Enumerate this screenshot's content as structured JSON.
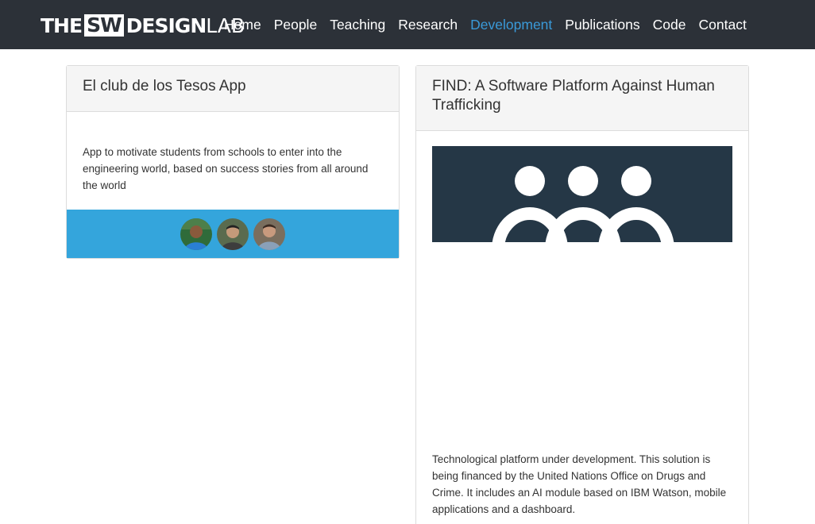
{
  "brand": {
    "part1": "THE",
    "part2": "SW",
    "part3": "DESIGN",
    "part4": "LAB"
  },
  "nav": {
    "items": [
      {
        "label": "Home",
        "active": false
      },
      {
        "label": "People",
        "active": false
      },
      {
        "label": "Teaching",
        "active": false
      },
      {
        "label": "Research",
        "active": false
      },
      {
        "label": "Development",
        "active": true
      },
      {
        "label": "Publications",
        "active": false
      },
      {
        "label": "Code",
        "active": false
      },
      {
        "label": "Contact",
        "active": false
      }
    ]
  },
  "projects": [
    {
      "title": "El club de los Tesos App",
      "description": "App to motivate students from schools to enter into the engineering world, based on success stories from all around the world",
      "team_count": 3
    },
    {
      "title": "FIND: A Software Platform Against Human Trafficking",
      "description": "Technological platform under development. This solution is being financed by the United Nations Office on Drugs and Crime. It includes an AI module based on IBM Watson, mobile applications and a dashboard."
    }
  ],
  "colors": {
    "navbar_bg": "#2c3138",
    "active_link": "#3a9ad9",
    "card_footer": "#34a5dc",
    "image_bg": "#253746"
  },
  "icons": [
    "people-icon",
    "avatar"
  ]
}
